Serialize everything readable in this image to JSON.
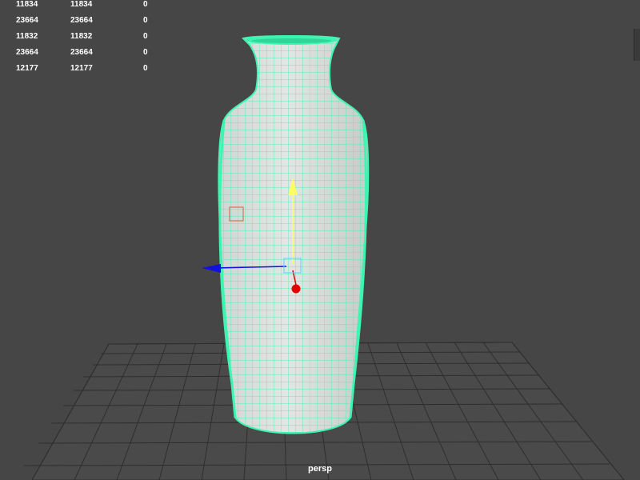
{
  "viewport": {
    "camera_label": "persp",
    "background_color": "#464646",
    "grid_color": "#2e2e2e",
    "mesh_wire_color": "#3cf5b0",
    "mesh_fill_color": "#d8dfdc",
    "axis_colors": {
      "x": "#1010e0",
      "y": "#ffff60",
      "z": "#e00000"
    }
  },
  "poly_stats": {
    "rows": [
      [
        "11834",
        "11834",
        "0"
      ],
      [
        "23664",
        "23664",
        "0"
      ],
      [
        "11832",
        "11832",
        "0"
      ],
      [
        "23664",
        "23664",
        "0"
      ],
      [
        "12177",
        "12177",
        "0"
      ]
    ]
  },
  "objects": {
    "mesh_icon": "vase-mesh",
    "manipulator_icon": "move-manipulator"
  }
}
